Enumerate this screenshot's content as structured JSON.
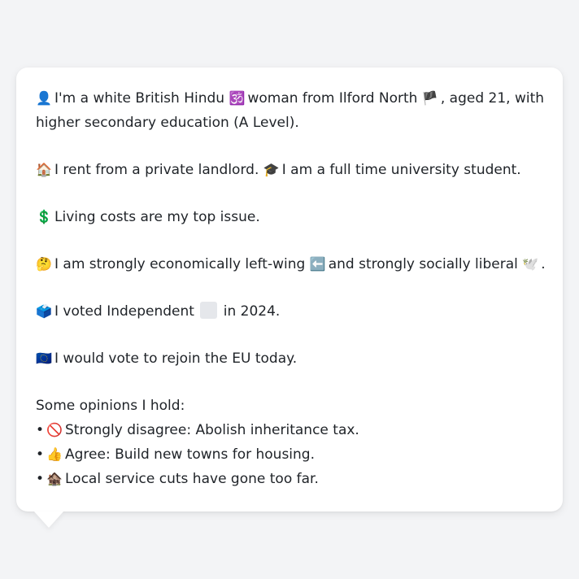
{
  "profile": {
    "identity": {
      "icon": "person-silhouette",
      "part1": "I'm a white British Hindu",
      "religion_icon": "om-symbol",
      "part2": "woman from Ilford North",
      "flag_icon": "england-flag",
      "part3": ", aged 21, with",
      "line2": "higher secondary education (A Level)."
    },
    "housing": {
      "icon": "house",
      "text": "I rent from a private landlord.",
      "education_icon": "graduation-cap",
      "text2": "I am a full time university student."
    },
    "issue": {
      "icon": "dollar-sign",
      "text": "Living costs are my top issue."
    },
    "politics": {
      "icon": "thinking-face",
      "text1": "I am strongly economically left-wing",
      "left_icon": "left-arrow",
      "text2": "and strongly socially liberal",
      "dove_icon": "dove",
      "text3": "."
    },
    "vote": {
      "icon": "ballot-box",
      "text1": "I voted Independent",
      "text2": "in 2024."
    },
    "eu": {
      "icon": "eu-flag",
      "text": "I would vote to rejoin the EU today."
    },
    "opinions": {
      "heading": "Some opinions I hold:",
      "bullet": "•",
      "items": [
        {
          "icon": "prohibited",
          "text": "Strongly disagree: Abolish inheritance tax."
        },
        {
          "icon": "thumbs-up",
          "text": "Agree: Build new towns for housing."
        },
        {
          "icon": "derelict-house",
          "text": "Local service cuts have gone too far."
        }
      ]
    }
  },
  "colors": {
    "background": "#f3f4f6",
    "card": "#ffffff",
    "text": "#1f2328"
  }
}
